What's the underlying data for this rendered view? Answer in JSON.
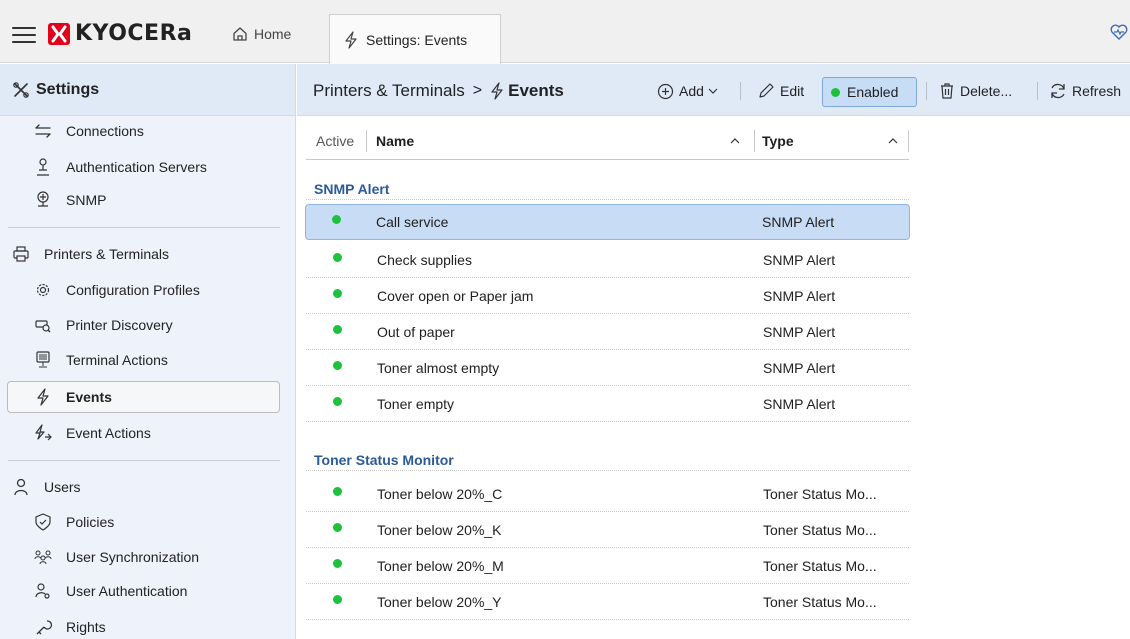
{
  "app": {
    "logo_text": "KYOCERa",
    "home_label": "Home",
    "active_tab_label": "Settings: Events"
  },
  "sidebar": {
    "header": "Settings",
    "items": [
      {
        "label": "Connections",
        "icon": "connections-icon"
      },
      {
        "label": "Authentication Servers",
        "icon": "authentication-servers-icon"
      },
      {
        "label": "SNMP",
        "icon": "snmp-icon"
      },
      {
        "label": "Printers & Terminals",
        "icon": "printer-icon"
      },
      {
        "label": "Configuration Profiles",
        "icon": "gear-icon"
      },
      {
        "label": "Printer Discovery",
        "icon": "printer-discovery-icon"
      },
      {
        "label": "Terminal Actions",
        "icon": "terminal-icon"
      },
      {
        "label": "Events",
        "icon": "lightning-icon"
      },
      {
        "label": "Event Actions",
        "icon": "event-actions-icon"
      },
      {
        "label": "Users",
        "icon": "user-icon"
      },
      {
        "label": "Policies",
        "icon": "shield-icon"
      },
      {
        "label": "User Synchronization",
        "icon": "user-sync-icon"
      },
      {
        "label": "User Authentication",
        "icon": "user-auth-icon"
      },
      {
        "label": "Rights",
        "icon": "rights-icon"
      }
    ]
  },
  "toolbar": {
    "breadcrumb_parent": "Printers & Terminals",
    "breadcrumb_sep": ">",
    "breadcrumb_current": "Events",
    "add_label": "Add",
    "edit_label": "Edit",
    "enabled_label": "Enabled",
    "delete_label": "Delete...",
    "refresh_label": "Refresh"
  },
  "grid": {
    "columns": {
      "active": "Active",
      "name": "Name",
      "type": "Type"
    },
    "groups": [
      {
        "name": "SNMP Alert",
        "rows": [
          {
            "name": "Call service",
            "type": "SNMP Alert"
          },
          {
            "name": "Check supplies",
            "type": "SNMP Alert"
          },
          {
            "name": "Cover open or Paper jam",
            "type": "SNMP Alert"
          },
          {
            "name": "Out of paper",
            "type": "SNMP Alert"
          },
          {
            "name": "Toner almost empty",
            "type": "SNMP Alert"
          },
          {
            "name": "Toner empty",
            "type": "SNMP Alert"
          }
        ]
      },
      {
        "name": "Toner Status Monitor",
        "rows": [
          {
            "name": "Toner below 20%_C",
            "type": "Toner Status Mo..."
          },
          {
            "name": "Toner below 20%_K",
            "type": "Toner Status Mo..."
          },
          {
            "name": "Toner below 20%_M",
            "type": "Toner Status Mo..."
          },
          {
            "name": "Toner below 20%_Y",
            "type": "Toner Status Mo..."
          }
        ]
      }
    ]
  },
  "colors": {
    "accent": "#2a5a9a",
    "active_dot": "#1ec23a",
    "selection": "#c8dcf6",
    "brand_red": "#e3001b"
  }
}
